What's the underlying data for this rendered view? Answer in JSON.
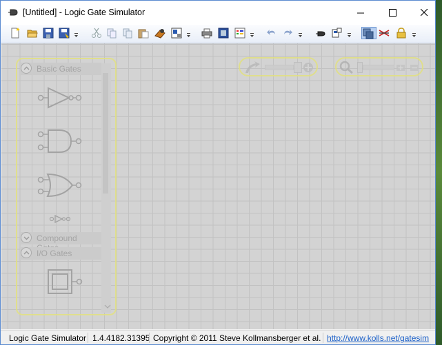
{
  "window": {
    "title": "[Untitled] - Logic Gate Simulator",
    "app_icon": "gate-app-icon",
    "controls": [
      "minimize-icon",
      "maximize-icon",
      "close-icon"
    ]
  },
  "toolbar": {
    "buttons": [
      {
        "name": "new",
        "icon": "new-file-icon"
      },
      {
        "name": "open",
        "icon": "open-folder-icon"
      },
      {
        "name": "save",
        "icon": "save-icon"
      },
      {
        "name": "save-as",
        "icon": "save-as-icon"
      },
      {
        "name": "cut",
        "icon": "cut-icon"
      },
      {
        "name": "copy",
        "icon": "copy-icon"
      },
      {
        "name": "copy-as-image",
        "icon": "copy-image-icon"
      },
      {
        "name": "paste",
        "icon": "paste-icon"
      },
      {
        "name": "user-gate",
        "icon": "chip-icon"
      },
      {
        "name": "export",
        "icon": "export-icon"
      },
      {
        "name": "print",
        "icon": "print-icon"
      },
      {
        "name": "print-preview",
        "icon": "print-preview-icon"
      },
      {
        "name": "chart",
        "icon": "chart-icon"
      },
      {
        "name": "undo",
        "icon": "undo-icon"
      },
      {
        "name": "redo",
        "icon": "redo-icon"
      },
      {
        "name": "show-grid",
        "icon": "grid-icon"
      },
      {
        "name": "integrated-circuit",
        "icon": "ic-icon"
      },
      {
        "name": "overlay",
        "icon": "overlay-icon",
        "active": true
      },
      {
        "name": "wires",
        "icon": "wires-icon"
      },
      {
        "name": "lock",
        "icon": "lock-icon"
      }
    ]
  },
  "toolbox": {
    "sections": [
      {
        "label": "Basic Gates",
        "expanded": true
      },
      {
        "label": "Compound Gates",
        "expanded": false
      },
      {
        "label": "I/O Gates",
        "expanded": true
      }
    ]
  },
  "status": {
    "app_name": "Logic Gate Simulator",
    "version": "1.4.4182.31395",
    "copyright": "Copyright © 2011 Steve Kollmansberger et al.",
    "link": "http://www.kolls.net/gatesim"
  },
  "colors": {
    "canvas": "#d3d3d3",
    "grid": "#c2c2c2",
    "highlight_border": "#e2e080",
    "link": "#1a5fc8"
  }
}
